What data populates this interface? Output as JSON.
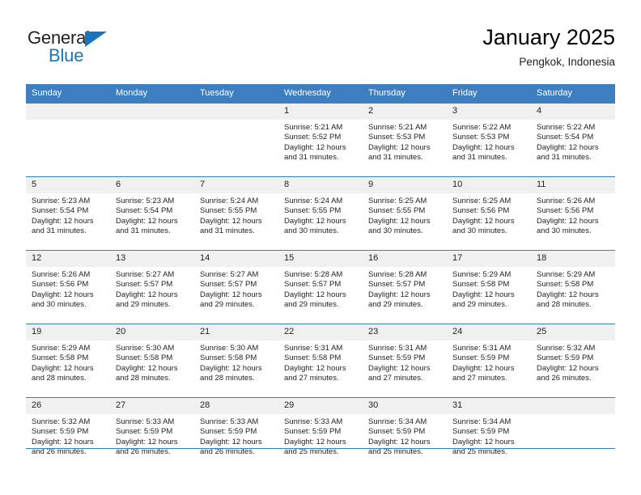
{
  "brand": {
    "name_top": "General",
    "name_bottom": "Blue",
    "triangle_color": "#1b75bc"
  },
  "header": {
    "title": "January 2025",
    "subtitle": "Pengkok, Indonesia"
  },
  "theme": {
    "header_blue": "#3c7ebf",
    "daynum_band": "#f0f0f0",
    "text": "#231f20"
  },
  "weekdays": [
    "Sunday",
    "Monday",
    "Tuesday",
    "Wednesday",
    "Thursday",
    "Friday",
    "Saturday"
  ],
  "weeks": [
    [
      {
        "day": "",
        "sunrise": "",
        "sunset": "",
        "daylight_line1": "",
        "daylight_line2": ""
      },
      {
        "day": "",
        "sunrise": "",
        "sunset": "",
        "daylight_line1": "",
        "daylight_line2": ""
      },
      {
        "day": "",
        "sunrise": "",
        "sunset": "",
        "daylight_line1": "",
        "daylight_line2": ""
      },
      {
        "day": "1",
        "sunrise": "Sunrise: 5:21 AM",
        "sunset": "Sunset: 5:52 PM",
        "daylight_line1": "Daylight: 12 hours",
        "daylight_line2": "and 31 minutes."
      },
      {
        "day": "2",
        "sunrise": "Sunrise: 5:21 AM",
        "sunset": "Sunset: 5:53 PM",
        "daylight_line1": "Daylight: 12 hours",
        "daylight_line2": "and 31 minutes."
      },
      {
        "day": "3",
        "sunrise": "Sunrise: 5:22 AM",
        "sunset": "Sunset: 5:53 PM",
        "daylight_line1": "Daylight: 12 hours",
        "daylight_line2": "and 31 minutes."
      },
      {
        "day": "4",
        "sunrise": "Sunrise: 5:22 AM",
        "sunset": "Sunset: 5:54 PM",
        "daylight_line1": "Daylight: 12 hours",
        "daylight_line2": "and 31 minutes."
      }
    ],
    [
      {
        "day": "5",
        "sunrise": "Sunrise: 5:23 AM",
        "sunset": "Sunset: 5:54 PM",
        "daylight_line1": "Daylight: 12 hours",
        "daylight_line2": "and 31 minutes."
      },
      {
        "day": "6",
        "sunrise": "Sunrise: 5:23 AM",
        "sunset": "Sunset: 5:54 PM",
        "daylight_line1": "Daylight: 12 hours",
        "daylight_line2": "and 31 minutes."
      },
      {
        "day": "7",
        "sunrise": "Sunrise: 5:24 AM",
        "sunset": "Sunset: 5:55 PM",
        "daylight_line1": "Daylight: 12 hours",
        "daylight_line2": "and 31 minutes."
      },
      {
        "day": "8",
        "sunrise": "Sunrise: 5:24 AM",
        "sunset": "Sunset: 5:55 PM",
        "daylight_line1": "Daylight: 12 hours",
        "daylight_line2": "and 30 minutes."
      },
      {
        "day": "9",
        "sunrise": "Sunrise: 5:25 AM",
        "sunset": "Sunset: 5:55 PM",
        "daylight_line1": "Daylight: 12 hours",
        "daylight_line2": "and 30 minutes."
      },
      {
        "day": "10",
        "sunrise": "Sunrise: 5:25 AM",
        "sunset": "Sunset: 5:56 PM",
        "daylight_line1": "Daylight: 12 hours",
        "daylight_line2": "and 30 minutes."
      },
      {
        "day": "11",
        "sunrise": "Sunrise: 5:26 AM",
        "sunset": "Sunset: 5:56 PM",
        "daylight_line1": "Daylight: 12 hours",
        "daylight_line2": "and 30 minutes."
      }
    ],
    [
      {
        "day": "12",
        "sunrise": "Sunrise: 5:26 AM",
        "sunset": "Sunset: 5:56 PM",
        "daylight_line1": "Daylight: 12 hours",
        "daylight_line2": "and 30 minutes."
      },
      {
        "day": "13",
        "sunrise": "Sunrise: 5:27 AM",
        "sunset": "Sunset: 5:57 PM",
        "daylight_line1": "Daylight: 12 hours",
        "daylight_line2": "and 29 minutes."
      },
      {
        "day": "14",
        "sunrise": "Sunrise: 5:27 AM",
        "sunset": "Sunset: 5:57 PM",
        "daylight_line1": "Daylight: 12 hours",
        "daylight_line2": "and 29 minutes."
      },
      {
        "day": "15",
        "sunrise": "Sunrise: 5:28 AM",
        "sunset": "Sunset: 5:57 PM",
        "daylight_line1": "Daylight: 12 hours",
        "daylight_line2": "and 29 minutes."
      },
      {
        "day": "16",
        "sunrise": "Sunrise: 5:28 AM",
        "sunset": "Sunset: 5:57 PM",
        "daylight_line1": "Daylight: 12 hours",
        "daylight_line2": "and 29 minutes."
      },
      {
        "day": "17",
        "sunrise": "Sunrise: 5:29 AM",
        "sunset": "Sunset: 5:58 PM",
        "daylight_line1": "Daylight: 12 hours",
        "daylight_line2": "and 29 minutes."
      },
      {
        "day": "18",
        "sunrise": "Sunrise: 5:29 AM",
        "sunset": "Sunset: 5:58 PM",
        "daylight_line1": "Daylight: 12 hours",
        "daylight_line2": "and 28 minutes."
      }
    ],
    [
      {
        "day": "19",
        "sunrise": "Sunrise: 5:29 AM",
        "sunset": "Sunset: 5:58 PM",
        "daylight_line1": "Daylight: 12 hours",
        "daylight_line2": "and 28 minutes."
      },
      {
        "day": "20",
        "sunrise": "Sunrise: 5:30 AM",
        "sunset": "Sunset: 5:58 PM",
        "daylight_line1": "Daylight: 12 hours",
        "daylight_line2": "and 28 minutes."
      },
      {
        "day": "21",
        "sunrise": "Sunrise: 5:30 AM",
        "sunset": "Sunset: 5:58 PM",
        "daylight_line1": "Daylight: 12 hours",
        "daylight_line2": "and 28 minutes."
      },
      {
        "day": "22",
        "sunrise": "Sunrise: 5:31 AM",
        "sunset": "Sunset: 5:58 PM",
        "daylight_line1": "Daylight: 12 hours",
        "daylight_line2": "and 27 minutes."
      },
      {
        "day": "23",
        "sunrise": "Sunrise: 5:31 AM",
        "sunset": "Sunset: 5:59 PM",
        "daylight_line1": "Daylight: 12 hours",
        "daylight_line2": "and 27 minutes."
      },
      {
        "day": "24",
        "sunrise": "Sunrise: 5:31 AM",
        "sunset": "Sunset: 5:59 PM",
        "daylight_line1": "Daylight: 12 hours",
        "daylight_line2": "and 27 minutes."
      },
      {
        "day": "25",
        "sunrise": "Sunrise: 5:32 AM",
        "sunset": "Sunset: 5:59 PM",
        "daylight_line1": "Daylight: 12 hours",
        "daylight_line2": "and 26 minutes."
      }
    ],
    [
      {
        "day": "26",
        "sunrise": "Sunrise: 5:32 AM",
        "sunset": "Sunset: 5:59 PM",
        "daylight_line1": "Daylight: 12 hours",
        "daylight_line2": "and 26 minutes."
      },
      {
        "day": "27",
        "sunrise": "Sunrise: 5:33 AM",
        "sunset": "Sunset: 5:59 PM",
        "daylight_line1": "Daylight: 12 hours",
        "daylight_line2": "and 26 minutes."
      },
      {
        "day": "28",
        "sunrise": "Sunrise: 5:33 AM",
        "sunset": "Sunset: 5:59 PM",
        "daylight_line1": "Daylight: 12 hours",
        "daylight_line2": "and 26 minutes."
      },
      {
        "day": "29",
        "sunrise": "Sunrise: 5:33 AM",
        "sunset": "Sunset: 5:59 PM",
        "daylight_line1": "Daylight: 12 hours",
        "daylight_line2": "and 25 minutes."
      },
      {
        "day": "30",
        "sunrise": "Sunrise: 5:34 AM",
        "sunset": "Sunset: 5:59 PM",
        "daylight_line1": "Daylight: 12 hours",
        "daylight_line2": "and 25 minutes."
      },
      {
        "day": "31",
        "sunrise": "Sunrise: 5:34 AM",
        "sunset": "Sunset: 5:59 PM",
        "daylight_line1": "Daylight: 12 hours",
        "daylight_line2": "and 25 minutes."
      },
      {
        "day": "",
        "sunrise": "",
        "sunset": "",
        "daylight_line1": "",
        "daylight_line2": ""
      }
    ]
  ]
}
